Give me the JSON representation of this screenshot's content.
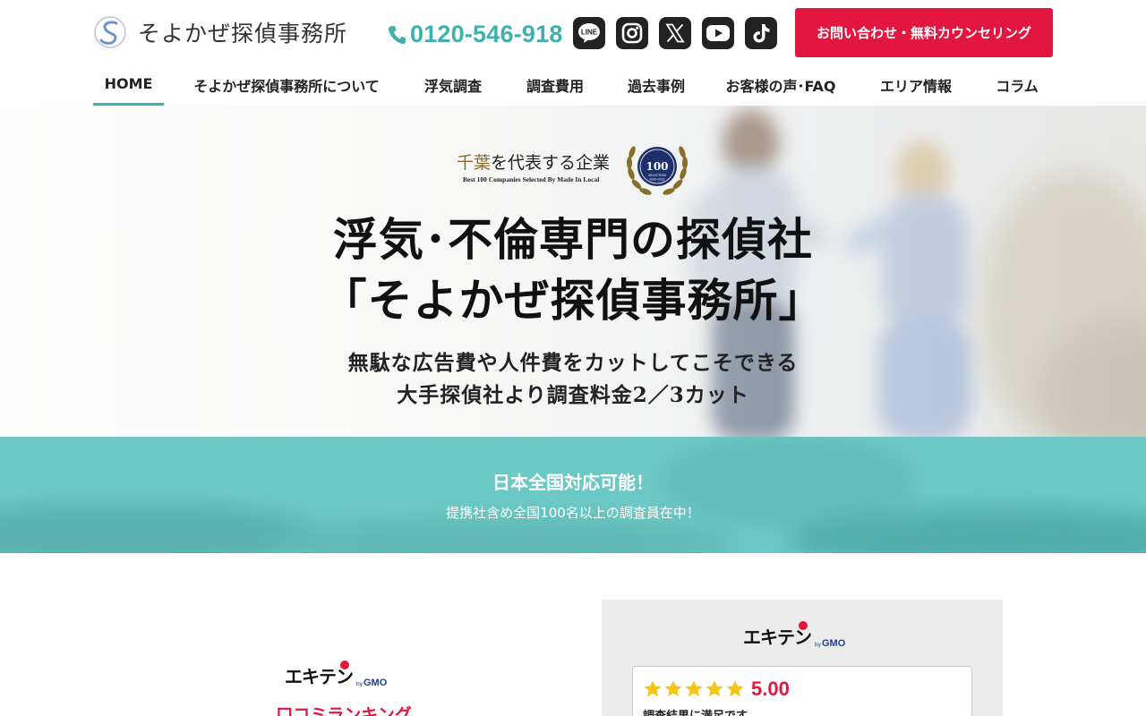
{
  "header": {
    "logo_text": "そよかぜ探偵事務所",
    "phone": "0120-546-918",
    "social": [
      {
        "name": "line",
        "label": "LINE"
      },
      {
        "name": "instagram",
        "label": ""
      },
      {
        "name": "x",
        "label": ""
      },
      {
        "name": "youtube",
        "label": ""
      },
      {
        "name": "tiktok",
        "label": ""
      }
    ],
    "cta_label": "お問い合わせ・無料カウンセリング"
  },
  "nav": {
    "items": [
      {
        "label": "HOME",
        "active": true
      },
      {
        "label": "そよかぜ探偵事務所について"
      },
      {
        "label": "浮気調査"
      },
      {
        "label": "調査費用"
      },
      {
        "label": "過去事例"
      },
      {
        "label": "お客様の声･FAQ"
      },
      {
        "label": "エリア情報"
      },
      {
        "label": "コラム"
      }
    ]
  },
  "hero": {
    "badge_accent": "千葉",
    "badge_rest": "を代表する企業",
    "badge_sub": "Best 100 Companies Selected By Made In Local",
    "laurel_number": "100",
    "laurel_caption": "SELECTION",
    "laurel_years": "2020-2022",
    "title_line1": "浮気･不倫専門の探偵社",
    "title_line2": "「そよかぜ探偵事務所」",
    "sub_line1": "無駄な広告費や人件費をカットしてこそできる",
    "sub_line2": "大手探偵社より調査料金2／3カット"
  },
  "band": {
    "title": "日本全国対応可能！",
    "subtitle": "提携社含め全国100名以上の調査員在中！"
  },
  "ranking": {
    "logo_word": "エキテン",
    "logo_by": "by",
    "logo_brand": "GMO",
    "title": "口コミランキング"
  },
  "review": {
    "logo_word": "エキテン",
    "logo_by": "by",
    "logo_brand": "GMO",
    "rating": 5.0,
    "score_text": "5.00",
    "text": "調査結果に満足です。"
  },
  "colors": {
    "accent_teal": "#3fb1ad",
    "cta_red": "#e3163f",
    "band_teal": "#6cc8c4",
    "laurel_gold": "#8a6d2d",
    "laurel_navy": "#1f2f6b",
    "star_yellow": "#f5c518"
  },
  "icons": {
    "logo": "s-swirl-logo-icon",
    "phone": "phone-icon",
    "star": "star-icon"
  }
}
